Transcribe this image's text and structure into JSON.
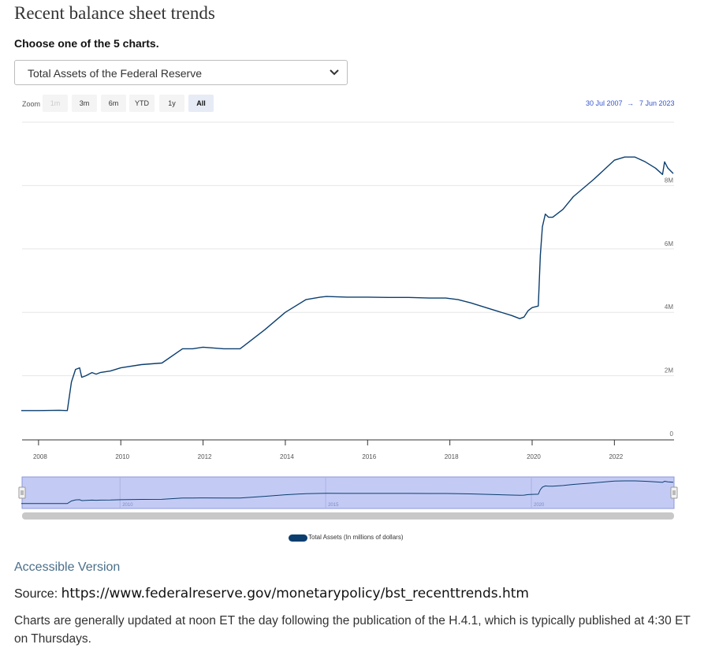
{
  "page": {
    "title": "Recent balance sheet trends",
    "subtitle": "Choose one of the 5 charts.",
    "select_value": "Total Assets of the Federal Reserve"
  },
  "zoom": {
    "label": "Zoom",
    "buttons": [
      "1m",
      "3m",
      "6m",
      "YTD",
      "1y",
      "All"
    ],
    "active": "All",
    "disabled": [
      "1m"
    ]
  },
  "range": {
    "from": "30 Jul 2007",
    "arrow": "→",
    "to": "7 Jun 2023"
  },
  "chart_data": {
    "type": "line",
    "x_unit": "year",
    "xlim": [
      2007.6,
      2023.45
    ],
    "ylim": [
      0,
      10000000
    ],
    "y_ticks": [
      0,
      2000000,
      4000000,
      6000000,
      8000000
    ],
    "y_tick_labels": [
      "0",
      "2M",
      "4M",
      "6M",
      "8M"
    ],
    "x_ticks": [
      2008,
      2010,
      2012,
      2014,
      2016,
      2018,
      2020,
      2022
    ],
    "x_tick_labels": [
      "2008",
      "2010",
      "2012",
      "2014",
      "2016",
      "2018",
      "2020",
      "2022"
    ],
    "navigator_tick_labels": [
      "2010",
      "2015",
      "2020"
    ],
    "navigator_ticks": [
      2010,
      2015,
      2020
    ],
    "grid": true,
    "legend_position": "bottom-center",
    "series": [
      {
        "name": "Total Assets (In millions of dollars)",
        "color": "#0b3e6f",
        "x": [
          2007.58,
          2008.0,
          2008.5,
          2008.7,
          2008.8,
          2008.9,
          2009.0,
          2009.05,
          2009.15,
          2009.3,
          2009.4,
          2009.5,
          2009.75,
          2010.0,
          2010.5,
          2011.0,
          2011.5,
          2011.75,
          2012.0,
          2012.5,
          2012.9,
          2013.0,
          2013.5,
          2014.0,
          2014.5,
          2014.85,
          2015.0,
          2015.5,
          2016.0,
          2016.5,
          2017.0,
          2017.5,
          2017.9,
          2018.2,
          2018.5,
          2019.0,
          2019.5,
          2019.7,
          2019.8,
          2019.9,
          2020.0,
          2020.15,
          2020.2,
          2020.25,
          2020.32,
          2020.4,
          2020.5,
          2020.75,
          2021.0,
          2021.5,
          2022.0,
          2022.25,
          2022.5,
          2022.75,
          2023.0,
          2023.17,
          2023.22,
          2023.3,
          2023.43
        ],
        "y": [
          900000,
          900000,
          910000,
          900000,
          1800000,
          2200000,
          2250000,
          1950000,
          2000000,
          2100000,
          2050000,
          2100000,
          2150000,
          2250000,
          2350000,
          2400000,
          2850000,
          2850000,
          2900000,
          2850000,
          2850000,
          2950000,
          3450000,
          4000000,
          4400000,
          4480000,
          4500000,
          4480000,
          4480000,
          4470000,
          4470000,
          4450000,
          4450000,
          4400000,
          4300000,
          4100000,
          3900000,
          3800000,
          3850000,
          4050000,
          4150000,
          4200000,
          5800000,
          6700000,
          7100000,
          7000000,
          7000000,
          7250000,
          7650000,
          8200000,
          8800000,
          8900000,
          8900000,
          8750000,
          8550000,
          8350000,
          8750000,
          8550000,
          8380000
        ]
      }
    ]
  },
  "links": {
    "accessible": "Accessible Version",
    "source_label": "Source:",
    "source_url": "https://www.federalreserve.gov/monetarypolicy/bst_recenttrends.htm",
    "note": "Charts are generally updated at noon ET the day following the publication of the H.4.1, which is typically published at 4:30 ET on Thursdays."
  }
}
